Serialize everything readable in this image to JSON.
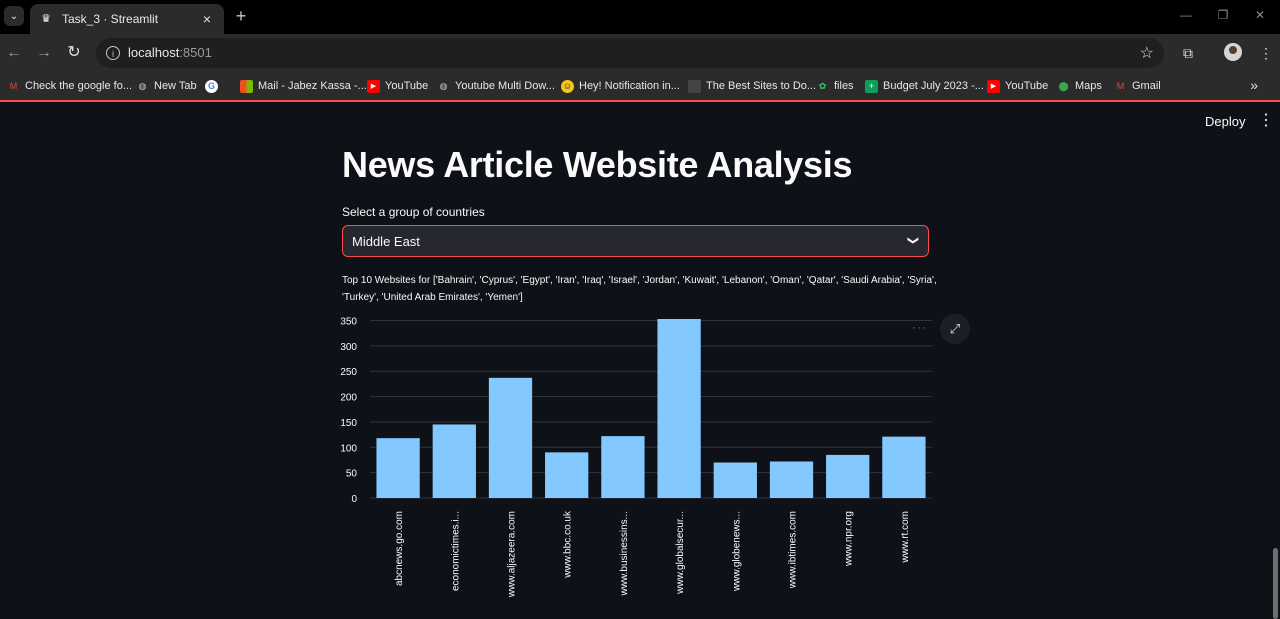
{
  "browser": {
    "tab_title": "Task_3 · Streamlit",
    "url_host": "localhost",
    "url_port": ":8501",
    "bookmarks": [
      {
        "label": "Check the google fo...",
        "icon": "gmail-icon",
        "color": "#ea4335"
      },
      {
        "label": "New Tab",
        "icon": "globe-icon",
        "color": "#c8c8c8"
      },
      {
        "label": "",
        "icon": "google-icon",
        "color": "#4285f4"
      },
      {
        "label": "Mail - Jabez Kassa -...",
        "icon": "microsoft-icon",
        "color": "#f25022"
      },
      {
        "label": "YouTube",
        "icon": "youtube-icon",
        "color": "#ff0000"
      },
      {
        "label": "Youtube Multi Dow...",
        "icon": "globe-icon",
        "color": "#c8c8c8"
      },
      {
        "label": "Hey! Notification in...",
        "icon": "notification-icon",
        "color": "#f5c518"
      },
      {
        "label": "The Best Sites to Do...",
        "icon": "page-icon",
        "color": "#666666"
      },
      {
        "label": "files",
        "icon": "files-icon",
        "color": "#2ecc71"
      },
      {
        "label": "Budget July 2023 -...",
        "icon": "sheets-icon",
        "color": "#0f9d58"
      },
      {
        "label": "YouTube",
        "icon": "youtube-icon",
        "color": "#ff0000"
      },
      {
        "label": "Maps",
        "icon": "maps-icon",
        "color": "#34a853"
      },
      {
        "label": "Gmail",
        "icon": "gmail-icon",
        "color": "#ea4335"
      }
    ]
  },
  "app": {
    "deploy_label": "Deploy",
    "title": "News Article Website Analysis",
    "select_label": "Select a group of countries",
    "select_value": "Middle East",
    "accent_color": "#ff4b4b"
  },
  "chart_data": {
    "type": "bar",
    "title": "Top 10 Websites for ['Bahrain', 'Cyprus', 'Egypt', 'Iran', 'Iraq', 'Israel', 'Jordan', 'Kuwait', 'Lebanon', 'Oman', 'Qatar', 'Saudi Arabia', 'Syria', 'Turkey', 'United Arab Emirates', 'Yemen']",
    "categories": [
      "abcnews.go.com",
      "economictimes.i...",
      "www.aljazeera.com",
      "www.bbc.co.uk",
      "www.businessins...",
      "www.globalsecur...",
      "www.globenews...",
      "www.ibtimes.com",
      "www.npr.org",
      "www.rt.com"
    ],
    "values": [
      118,
      145,
      237,
      90,
      122,
      353,
      70,
      72,
      85,
      121
    ],
    "ylim": [
      0,
      353
    ],
    "yticks": [
      0,
      50,
      100,
      150,
      200,
      250,
      300,
      350
    ],
    "bar_color": "#83c9ff",
    "grid": true
  }
}
